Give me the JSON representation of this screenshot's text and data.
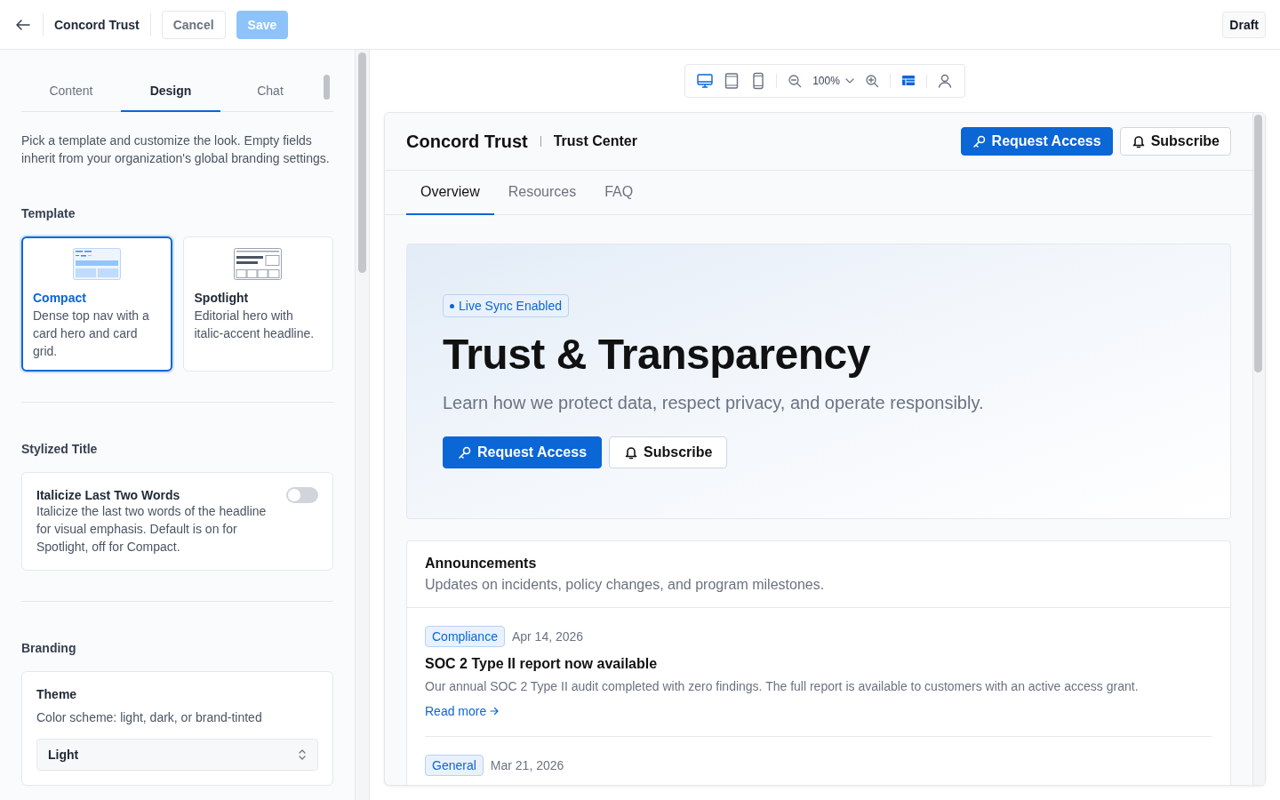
{
  "header": {
    "title": "Concord Trust",
    "buttons": [
      {
        "label": "Cancel",
        "kind": "secondary",
        "disabled": false
      },
      {
        "label": "Save",
        "kind": "primary",
        "disabled": true
      }
    ],
    "status": "Draft"
  },
  "editor": {
    "tabs": [
      {
        "label": "Content",
        "selected": false
      },
      {
        "label": "Design",
        "selected": true
      },
      {
        "label": "Chat",
        "selected": false
      }
    ],
    "intro": "Pick a template and customize the look. Empty fields inherit from your organization's global branding settings.",
    "sections": [
      {
        "kind": "template",
        "title": "Template",
        "templates": [
          {
            "kind": "compact",
            "name": "Compact",
            "description": "Dense top nav with a card hero and card grid.",
            "selected": true
          },
          {
            "kind": "spotlight",
            "name": "Spotlight",
            "description": "Editorial hero with italic-accent headline.",
            "selected": false
          }
        ]
      },
      {
        "kind": "toggle",
        "title": "Stylized Title",
        "label": "Italicize Last Two Words",
        "description": "Italicize the last two words of the headline for visual emphasis. Default is on for Spotlight, off for Compact.",
        "on": false
      },
      {
        "kind": "select",
        "title": "Branding",
        "label": "Theme",
        "description": "Color scheme: light, dark, or brand-tinted",
        "value": "Light"
      }
    ]
  },
  "preview_toolbar": {
    "devices": [
      {
        "kind": "desktop",
        "selected": true
      },
      {
        "kind": "tablet",
        "selected": false
      },
      {
        "kind": "phone",
        "selected": false
      }
    ],
    "zoom": "100%",
    "views": [
      {
        "kind": "layout",
        "selected": true
      },
      {
        "kind": "user",
        "selected": false
      }
    ]
  },
  "preview": {
    "brand": "Concord Trust",
    "section": "Trust Center",
    "actions": [
      {
        "label": "Request Access",
        "kind": "primary"
      },
      {
        "label": "Subscribe",
        "kind": "secondary"
      }
    ],
    "tabs": [
      {
        "label": "Overview",
        "selected": true
      },
      {
        "label": "Resources",
        "selected": false
      },
      {
        "label": "FAQ",
        "selected": false
      }
    ],
    "hero": {
      "badge": "Live Sync Enabled",
      "title": "Trust & Transparency",
      "subtitle": "Learn how we protect data, respect privacy, and operate responsibly.",
      "actions": [
        {
          "label": "Request Access",
          "kind": "primary"
        },
        {
          "label": "Subscribe",
          "kind": "secondary"
        }
      ]
    },
    "announcements": {
      "title": "Announcements",
      "subtitle": "Updates on incidents, policy changes, and program milestones.",
      "items": [
        {
          "tag": "Compliance",
          "date": "Apr 14, 2026",
          "title": "SOC 2 Type II report now available",
          "body": "Our annual SOC 2 Type II audit completed with zero findings. The full report is available to customers with an active access grant.",
          "link": "Read more"
        },
        {
          "tag": "General",
          "date": "Mar 21, 2026"
        }
      ]
    }
  }
}
